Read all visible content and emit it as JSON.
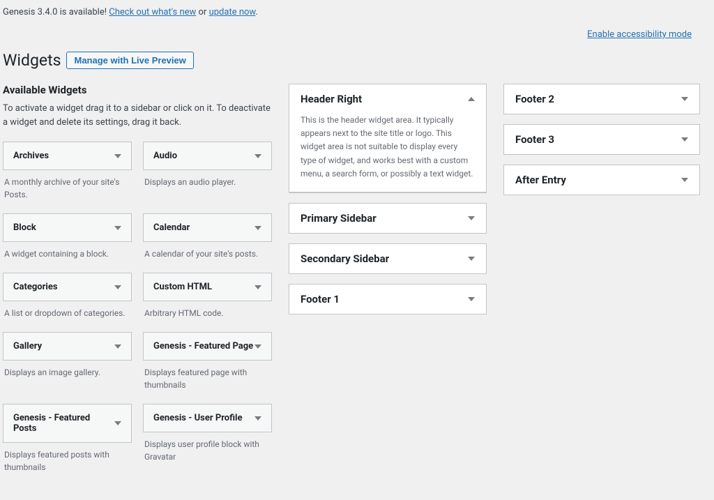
{
  "notice": {
    "prefix": "Genesis 3.4.0 is available! ",
    "link1": "Check out what's new",
    "or": " or ",
    "link2": "update now",
    "suffix": "."
  },
  "access_link": "Enable accessibility mode",
  "heading": "Widgets",
  "manage_btn": "Manage with Live Preview",
  "available": {
    "title": "Available Widgets",
    "desc": "To activate a widget drag it to a sidebar or click on it. To deactivate a widget and delete its settings, drag it back."
  },
  "widgets": [
    {
      "title": "Archives",
      "desc": "A monthly archive of your site's Posts."
    },
    {
      "title": "Audio",
      "desc": "Displays an audio player."
    },
    {
      "title": "Block",
      "desc": "A widget containing a block."
    },
    {
      "title": "Calendar",
      "desc": "A calendar of your site's posts."
    },
    {
      "title": "Categories",
      "desc": "A list or dropdown of categories."
    },
    {
      "title": "Custom HTML",
      "desc": "Arbitrary HTML code."
    },
    {
      "title": "Gallery",
      "desc": "Displays an image gallery."
    },
    {
      "title": "Genesis - Featured Page",
      "desc": "Displays featured page with thumbnails"
    },
    {
      "title": "Genesis - Featured Posts",
      "desc": "Displays featured posts with thumbnails"
    },
    {
      "title": "Genesis - User Profile",
      "desc": "Displays user profile block with Gravatar"
    }
  ],
  "areas_mid": [
    {
      "title": "Header Right",
      "expanded": true,
      "desc": "This is the header widget area. It typically appears next to the site title or logo. This widget area is not suitable to display every type of widget, and works best with a custom menu, a search form, or possibly a text widget."
    },
    {
      "title": "Primary Sidebar",
      "expanded": false,
      "desc": ""
    },
    {
      "title": "Secondary Sidebar",
      "expanded": false,
      "desc": ""
    },
    {
      "title": "Footer 1",
      "expanded": false,
      "desc": ""
    }
  ],
  "areas_right": [
    {
      "title": "Footer 2"
    },
    {
      "title": "Footer 3"
    },
    {
      "title": "After Entry"
    }
  ]
}
